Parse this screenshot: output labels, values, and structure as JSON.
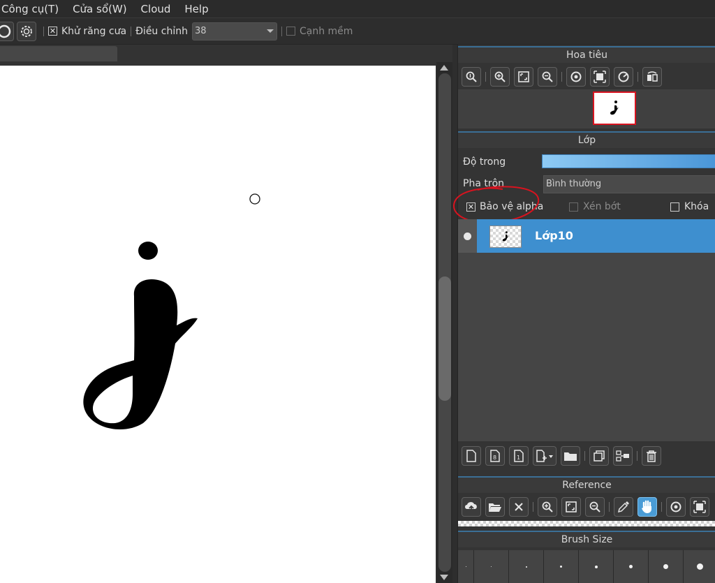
{
  "menu": {
    "items": [
      {
        "label": "Công cụ(T)"
      },
      {
        "label": "Cửa sổ(W)"
      },
      {
        "label": "Cloud"
      },
      {
        "label": "Help"
      }
    ]
  },
  "toolbar": {
    "antialias_label": "Khử răng cưa",
    "antialias_checked": true,
    "adjust_label": "Điều chỉnh",
    "adjust_value": "38",
    "soft_edge_label": "Cạnh mềm",
    "soft_edge_checked": false
  },
  "panels": {
    "navigator": {
      "title": "Hoa tiêu",
      "icons": [
        "zoom-fit-icon",
        "zoom-in-icon",
        "fit-screen-icon",
        "zoom-out-icon",
        "rotate-left-icon",
        "actual-size-icon",
        "rotate-right-icon",
        "flip-icon"
      ]
    },
    "layer": {
      "title": "Lớp",
      "opacity_label": "Độ trong",
      "opacity_value": 1.0,
      "blend_label": "Pha trộn",
      "blend_value": "Bình thường",
      "protect_alpha_label": "Bảo vệ alpha",
      "protect_alpha_checked": true,
      "clipping_label": "Xén bớt",
      "clipping_checked": false,
      "lock_label": "Khóa",
      "lock_checked": false,
      "layers": [
        {
          "name": "Lớp10",
          "selected": true,
          "visible": true
        }
      ],
      "bottom_icons": [
        "new-layer-icon",
        "new-8bit-layer-icon",
        "new-1bit-layer-icon",
        "add-layer-menu-icon",
        "folder-icon",
        "duplicate-icon",
        "merge-down-icon",
        "delete-icon"
      ]
    },
    "reference": {
      "title": "Reference",
      "icons": [
        "upload-icon",
        "open-folder-icon",
        "close-icon",
        "zoom-in-icon",
        "fit-screen-icon",
        "zoom-out-icon",
        "eyedropper-icon",
        "hand-icon",
        "rotate-icon",
        "actual-size-icon"
      ]
    },
    "brush_size": {
      "title": "Brush Size",
      "sizes": [
        1,
        1.5,
        2,
        3,
        4,
        5,
        7,
        10
      ]
    }
  },
  "colors": {
    "accent": "#4a9cd6",
    "selected_layer": "#3e8fcf",
    "annotation": "#d8131f"
  }
}
